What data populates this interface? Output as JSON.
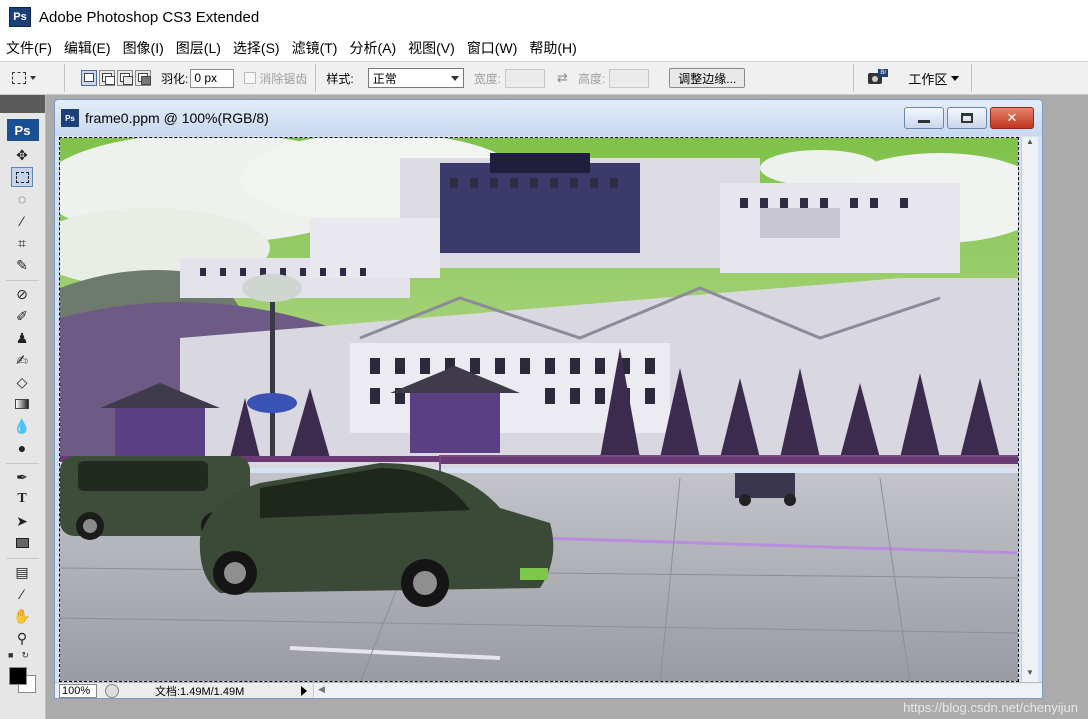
{
  "app": {
    "icon_label": "Ps",
    "title": "Adobe Photoshop CS3 Extended"
  },
  "menu": {
    "items": [
      "文件(F)",
      "编辑(E)",
      "图像(I)",
      "图层(L)",
      "选择(S)",
      "滤镜(T)",
      "分析(A)",
      "视图(V)",
      "窗口(W)",
      "帮助(H)"
    ]
  },
  "options": {
    "feather_label": "羽化:",
    "feather_value": "0 px",
    "antialias_label": "消除锯齿",
    "style_label": "样式:",
    "style_value": "正常",
    "width_label": "宽度:",
    "height_label": "高度:",
    "refine_edge_label": "调整边缘...",
    "workspace_label": "工作区"
  },
  "tools": {
    "ps_logo": "Ps"
  },
  "document": {
    "title": "frame0.ppm @ 100%(RGB/8)",
    "zoom": "100%",
    "doc_size": "文档:1.49M/1.49M"
  },
  "watermark": "https://blog.csdn.net/chenyijun",
  "colors": {
    "foreground": "#000000",
    "background": "#ffffff"
  }
}
